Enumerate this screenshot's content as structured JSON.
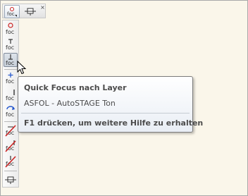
{
  "toolbar": {
    "header_buttons": [
      {
        "icon": "foc-main-icon"
      },
      {
        "icon": "toolbar-pin-icon"
      }
    ],
    "close_glyph": "×",
    "buttons": [
      {
        "label": "foc",
        "icon": "focus-object-icon"
      },
      {
        "label": "foc",
        "icon": "focus-top-icon"
      },
      {
        "label": "foc",
        "icon": "focus-layer-icon",
        "pressed": true
      },
      {
        "label": "foc",
        "icon": "focus-add-icon"
      },
      {
        "label": "foc",
        "icon": "focus-line-icon"
      },
      {
        "label": "foc",
        "icon": "focus-rotate-icon"
      },
      {
        "label": "foc",
        "icon": "focus-off-icon"
      },
      {
        "label": "foc",
        "icon": "focus-off-up-icon"
      },
      {
        "label": "foc",
        "icon": "focus-off-down-icon"
      },
      {
        "label": "",
        "icon": "toolbar-pin-icon"
      }
    ]
  },
  "tooltip": {
    "title": "Quick Focus nach Layer",
    "description": "ASFOL - AutoSTAGE Ton",
    "help": "F1 drücken, um weitere Hilfe zu erhalten"
  },
  "colors": {
    "accent_red": "#cc2222",
    "accent_blue": "#2255cc",
    "icon_text": "#333333"
  }
}
